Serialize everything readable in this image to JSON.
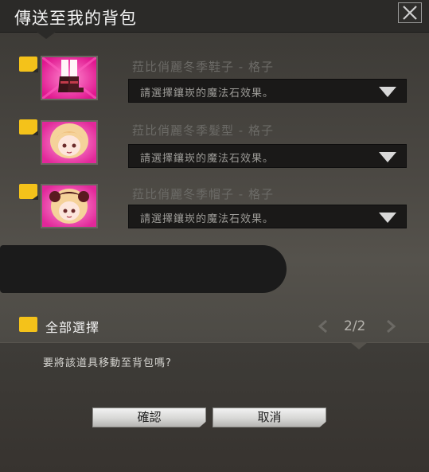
{
  "dialog": {
    "title": "傳送至我的背包",
    "close_icon": "close-icon"
  },
  "items": [
    {
      "name": "菈比俏麗冬季鞋子 - 格子",
      "select_placeholder": "請選擇鑲崁的魔法石效果。",
      "icon": "shoes-icon",
      "checked": true
    },
    {
      "name": "菈比俏麗冬季髮型 - 格子",
      "select_placeholder": "請選擇鑲崁的魔法石效果。",
      "icon": "hairstyle-icon",
      "checked": true
    },
    {
      "name": "菈比俏麗冬季帽子 - 格子",
      "select_placeholder": "請選擇鑲崁的魔法石效果。",
      "icon": "hat-icon",
      "checked": true
    }
  ],
  "footer": {
    "select_all_label": "全部選擇",
    "page_indicator": "2/2",
    "question": "要將該道具移動至背包嗎?",
    "confirm_label": "確認",
    "cancel_label": "取消"
  },
  "colors": {
    "checkbox": "#f4c21a",
    "title_bar": "#2b2a28",
    "panel": "#4a4742"
  }
}
